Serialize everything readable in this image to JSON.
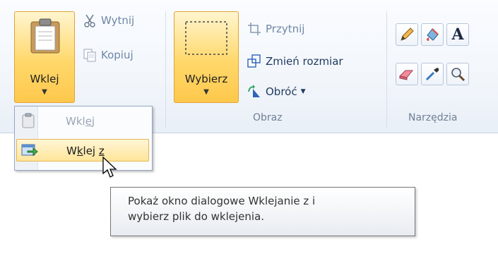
{
  "clipboard": {
    "paste_label": "Wklej",
    "cut_label": "Wytnij",
    "copy_label": "Kopiuj"
  },
  "image": {
    "select_label": "Wybierz",
    "crop_label": "Przytnij",
    "resize_label": "Zmień rozmiar",
    "rotate_label": "Obróć",
    "group_label": "Obraz"
  },
  "tools": {
    "group_label": "Narzędzia",
    "items": [
      "pencil-icon",
      "fill-icon",
      "text-icon",
      "eraser-icon",
      "color-picker-icon",
      "magnifier-icon"
    ],
    "text_glyph": "A"
  },
  "paste_menu": {
    "item1": {
      "pre": "Wkl",
      "ul": "e",
      "post": "j"
    },
    "item2": {
      "pre": "W",
      "ul": "k",
      "mid": "lej ",
      "ul2": "z"
    }
  },
  "tooltip": {
    "line1": "Pokaż okno dialogowe Wklejanie z i",
    "line2": "wybierz plik do wklejenia."
  },
  "colors": {
    "accent": "#fdc84c",
    "accent_border": "#e1a335",
    "ribbon_text": "#1f3a5f"
  }
}
